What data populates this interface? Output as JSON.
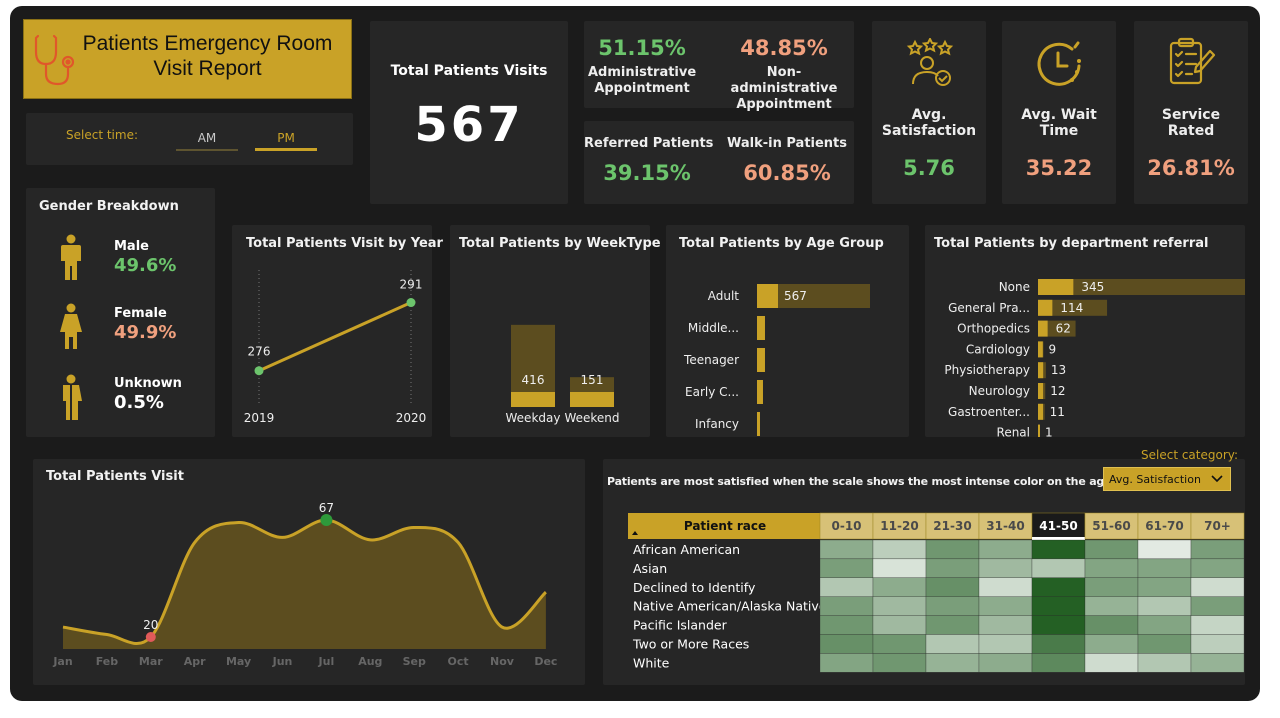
{
  "title": "Patients Emergency Room Visit Report",
  "time_filter": {
    "label": "Select time:",
    "options": [
      "AM",
      "PM"
    ],
    "selected": "PM"
  },
  "total_visits": {
    "label": "Total Patients Visits",
    "value": "567"
  },
  "appointments": {
    "admin_pct": "51.15%",
    "admin_label": "Administrative Appointment",
    "nonadmin_pct": "48.85%",
    "nonadmin_label": "Non- administrative Appointment"
  },
  "referral": {
    "referred_label": "Referred Patients",
    "referred_pct": "39.15%",
    "walkin_label": "Walk-in Patients",
    "walkin_pct": "60.85%"
  },
  "satisfaction": {
    "label": "Avg. Satisfaction",
    "value": "5.76",
    "icon": "satisfaction-stars-icon"
  },
  "wait_time": {
    "label": "Avg. Wait Time",
    "value": "35.22",
    "icon": "clock-icon"
  },
  "service": {
    "label": "Service Rated",
    "value": "26.81%",
    "icon": "clipboard-checklist-icon"
  },
  "gender": {
    "title": "Gender Breakdown",
    "items": [
      {
        "label": "Male",
        "value": "49.6%",
        "color": "#6cc46c",
        "icon": "male-person-icon"
      },
      {
        "label": "Female",
        "value": "49.9%",
        "color": "#f0a07e",
        "icon": "female-person-icon"
      },
      {
        "label": "Unknown",
        "value": "0.5%",
        "color": "#ffffff",
        "icon": "unknown-person-icon"
      }
    ]
  },
  "colors": {
    "accent": "#c9a227",
    "bar_fill": "#5c4d1f",
    "bar_dark": "#9a8420",
    "panel": "#262626",
    "green": "#6cc46c",
    "salmon": "#f0a07e",
    "marker_red": "#e05a5a",
    "marker_green": "#2e9a3a"
  },
  "chart_data": [
    {
      "id": "by_year",
      "type": "line",
      "title": "Total Patients Visit by Year",
      "categories": [
        "2019",
        "2020"
      ],
      "values": [
        276,
        291
      ]
    },
    {
      "id": "by_weektype",
      "type": "bar",
      "title": "Total Patients by WeekType",
      "categories": [
        "Weekday",
        "Weekend"
      ],
      "values": [
        416,
        151
      ],
      "ylim": [
        0,
        567
      ]
    },
    {
      "id": "by_age",
      "type": "bar",
      "title": "Total Patients by Age Group",
      "categories": [
        "Adult",
        "Middle...",
        "Teenager",
        "Early C...",
        "Infancy"
      ],
      "values": [
        567,
        40,
        40,
        30,
        15
      ],
      "labels_shown": [
        "567",
        "",
        "",
        "",
        ""
      ]
    },
    {
      "id": "by_department",
      "type": "bar",
      "title": "Total Patients by department referral",
      "categories": [
        "None",
        "General Pra...",
        "Orthopedics",
        "Cardiology",
        "Physiotherapy",
        "Neurology",
        "Gastroenter...",
        "Renal"
      ],
      "values": [
        345,
        114,
        62,
        9,
        13,
        12,
        11,
        1
      ]
    },
    {
      "id": "by_month",
      "type": "area",
      "title": "Total Patients Visit",
      "categories": [
        "Jan",
        "Feb",
        "Mar",
        "Apr",
        "May",
        "Jun",
        "Jul",
        "Aug",
        "Sep",
        "Oct",
        "Nov",
        "Dec"
      ],
      "values": [
        24,
        21,
        20,
        58,
        66,
        60,
        67,
        59,
        64,
        58,
        24,
        38
      ],
      "annotations": [
        {
          "category": "Mar",
          "label": "20"
        },
        {
          "category": "Jul",
          "label": "67"
        }
      ],
      "ylim": [
        20,
        67
      ]
    },
    {
      "id": "satisfaction_heatmap",
      "type": "heatmap",
      "title": "Patients are most satisfied when the scale shows the most intense color on the age group",
      "row_header": "Patient race",
      "columns": [
        "0-10",
        "11-20",
        "21-30",
        "31-40",
        "41-50",
        "51-60",
        "61-70",
        "70+"
      ],
      "highlighted_column": "41-50",
      "rows": [
        "African American",
        "Asian",
        "Declined to Identify",
        "Native American/Alaska Native",
        "Pacific Islander",
        "Two or More Races",
        "White"
      ],
      "values": [
        [
          0.45,
          0.2,
          0.6,
          0.45,
          1.0,
          0.6,
          0.0,
          0.55
        ],
        [
          0.55,
          0.05,
          0.55,
          0.35,
          0.25,
          0.5,
          0.5,
          0.5
        ],
        [
          0.25,
          0.45,
          0.65,
          0.1,
          1.0,
          0.55,
          0.5,
          0.1
        ],
        [
          0.55,
          0.35,
          0.55,
          0.45,
          1.0,
          0.4,
          0.25,
          0.55
        ],
        [
          0.6,
          0.35,
          0.6,
          0.35,
          1.0,
          0.65,
          0.5,
          0.15
        ],
        [
          0.65,
          0.6,
          0.25,
          0.25,
          0.8,
          0.45,
          0.6,
          0.2
        ],
        [
          0.5,
          0.6,
          0.4,
          0.45,
          0.7,
          0.1,
          0.25,
          0.4
        ]
      ]
    }
  ],
  "category_filter": {
    "label": "Select category:",
    "selected": "Avg. Satisfaction"
  }
}
